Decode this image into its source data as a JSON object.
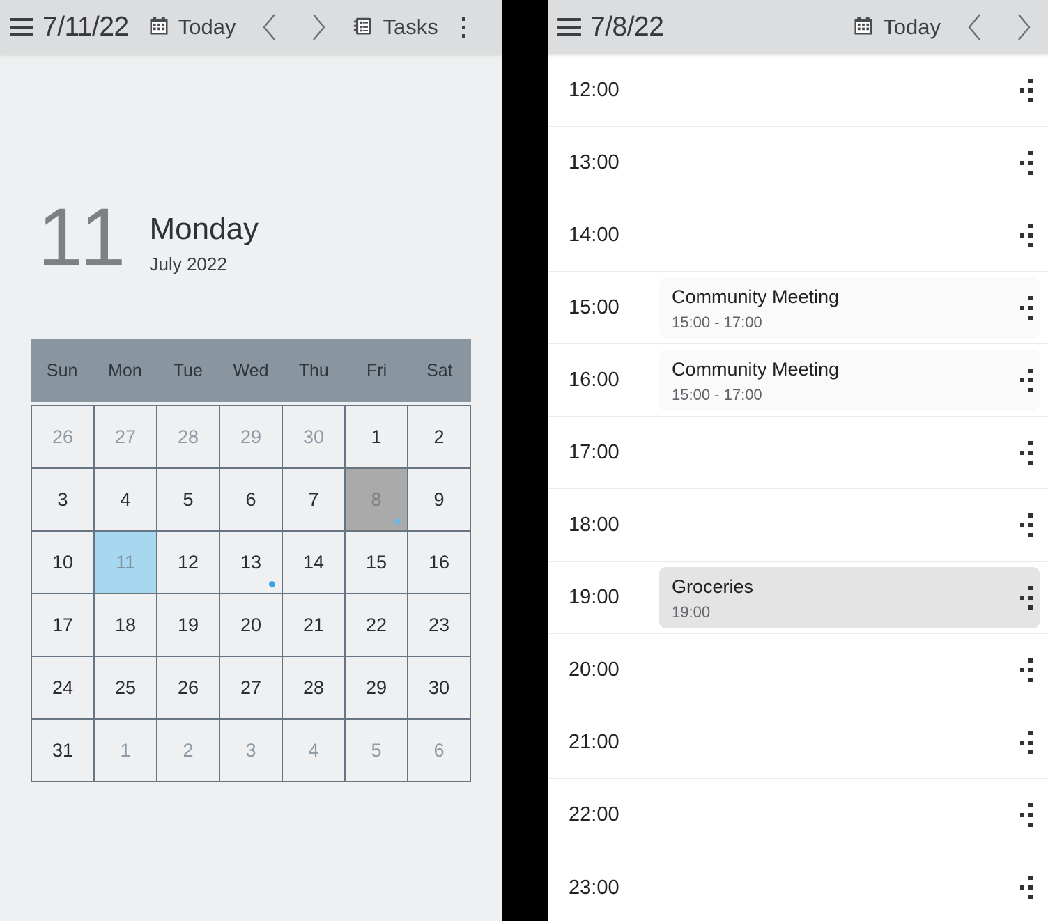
{
  "left": {
    "toolbar": {
      "menu_icon": "hamburger-icon",
      "date": "7/11/22",
      "today_icon": "calendar-icon",
      "today_label": "Today",
      "prev_icon": "chevron-left-icon",
      "next_icon": "chevron-right-icon",
      "tasks_icon": "tasks-notebook-icon",
      "tasks_label": "Tasks",
      "overflow_icon": "kebab-menu-icon"
    },
    "header": {
      "day_number": "11",
      "weekday": "Monday",
      "month_year": "July 2022"
    },
    "calendar": {
      "weekdays": [
        "Sun",
        "Mon",
        "Tue",
        "Wed",
        "Thu",
        "Fri",
        "Sat"
      ],
      "accent_today": "#a7d8f0",
      "accent_selected": "#aaaaaa",
      "accent_dot": "#3ba4e8",
      "header_bg": "#8a969f",
      "days": [
        {
          "n": "26",
          "state": "other"
        },
        {
          "n": "27",
          "state": "other"
        },
        {
          "n": "28",
          "state": "other"
        },
        {
          "n": "29",
          "state": "other"
        },
        {
          "n": "30",
          "state": "other"
        },
        {
          "n": "1",
          "state": "current"
        },
        {
          "n": "2",
          "state": "current"
        },
        {
          "n": "3",
          "state": "current"
        },
        {
          "n": "4",
          "state": "current"
        },
        {
          "n": "5",
          "state": "current"
        },
        {
          "n": "6",
          "state": "current"
        },
        {
          "n": "7",
          "state": "current"
        },
        {
          "n": "8",
          "state": "selected",
          "dot": true
        },
        {
          "n": "9",
          "state": "current"
        },
        {
          "n": "10",
          "state": "current"
        },
        {
          "n": "11",
          "state": "today"
        },
        {
          "n": "12",
          "state": "current"
        },
        {
          "n": "13",
          "state": "current",
          "dot": true
        },
        {
          "n": "14",
          "state": "current"
        },
        {
          "n": "15",
          "state": "current"
        },
        {
          "n": "16",
          "state": "current"
        },
        {
          "n": "17",
          "state": "current"
        },
        {
          "n": "18",
          "state": "current"
        },
        {
          "n": "19",
          "state": "current"
        },
        {
          "n": "20",
          "state": "current"
        },
        {
          "n": "21",
          "state": "current"
        },
        {
          "n": "22",
          "state": "current"
        },
        {
          "n": "23",
          "state": "current"
        },
        {
          "n": "24",
          "state": "current"
        },
        {
          "n": "25",
          "state": "current"
        },
        {
          "n": "26",
          "state": "current"
        },
        {
          "n": "27",
          "state": "current"
        },
        {
          "n": "28",
          "state": "current"
        },
        {
          "n": "29",
          "state": "current"
        },
        {
          "n": "30",
          "state": "current"
        },
        {
          "n": "31",
          "state": "current"
        },
        {
          "n": "1",
          "state": "other"
        },
        {
          "n": "2",
          "state": "other"
        },
        {
          "n": "3",
          "state": "other"
        },
        {
          "n": "4",
          "state": "other"
        },
        {
          "n": "5",
          "state": "other"
        },
        {
          "n": "6",
          "state": "other"
        }
      ]
    }
  },
  "right": {
    "toolbar": {
      "menu_icon": "hamburger-icon",
      "date": "7/8/22",
      "today_icon": "calendar-icon",
      "today_label": "Today",
      "prev_icon": "chevron-left-icon",
      "next_icon": "chevron-right-icon"
    },
    "hours": [
      {
        "time": "12:00"
      },
      {
        "time": "13:00"
      },
      {
        "time": "14:00"
      },
      {
        "time": "15:00",
        "event": {
          "title": "Community Meeting",
          "time": "15:00 - 17:00",
          "style": "light"
        }
      },
      {
        "time": "16:00",
        "event": {
          "title": "Community Meeting",
          "time": "15:00 - 17:00",
          "style": "light"
        }
      },
      {
        "time": "17:00"
      },
      {
        "time": "18:00"
      },
      {
        "time": "19:00",
        "event": {
          "title": "Groceries",
          "time": "19:00",
          "style": "dark"
        }
      },
      {
        "time": "20:00"
      },
      {
        "time": "21:00"
      },
      {
        "time": "22:00"
      },
      {
        "time": "23:00"
      }
    ]
  }
}
